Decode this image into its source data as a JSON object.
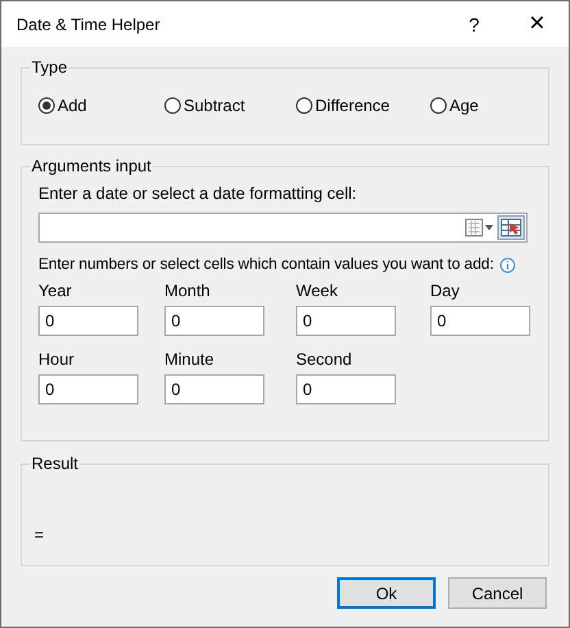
{
  "window": {
    "title": "Date & Time Helper",
    "help": "?",
    "close": "×"
  },
  "type_group": {
    "legend": "Type",
    "options": [
      {
        "label": "Add",
        "selected": true
      },
      {
        "label": "Subtract",
        "selected": false
      },
      {
        "label": "Difference",
        "selected": false
      },
      {
        "label": "Age",
        "selected": false
      }
    ]
  },
  "arguments_group": {
    "legend": "Arguments input",
    "date_label": "Enter a date or select a date formatting cell:",
    "values_label": "Enter numbers or select cells which contain values you want to add:",
    "fields": [
      {
        "label": "Year",
        "value": "0"
      },
      {
        "label": "Month",
        "value": "0"
      },
      {
        "label": "Week",
        "value": "0"
      },
      {
        "label": "Day",
        "value": "0"
      },
      {
        "label": "Hour",
        "value": "0"
      },
      {
        "label": "Minute",
        "value": "0"
      },
      {
        "label": "Second",
        "value": "0"
      }
    ]
  },
  "result_group": {
    "legend": "Result",
    "text": "="
  },
  "buttons": [
    {
      "label": "Ok",
      "default": true
    },
    {
      "label": "Cancel",
      "default": false
    }
  ]
}
